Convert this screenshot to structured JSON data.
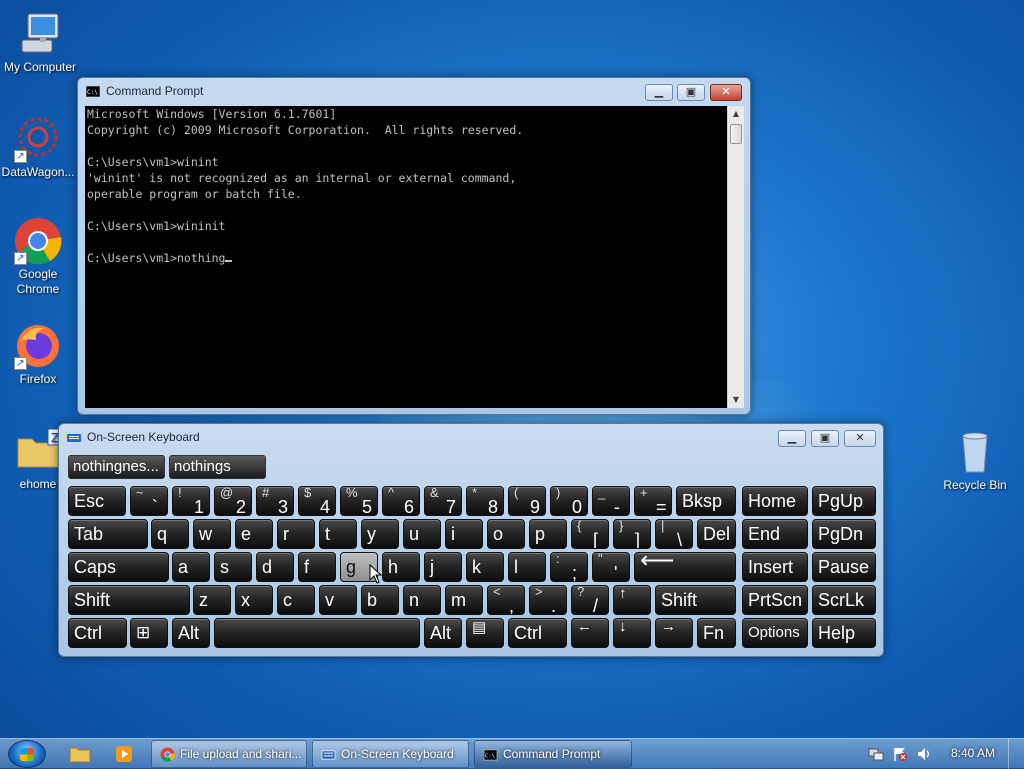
{
  "desktop": {
    "icons": [
      {
        "label": "My Computer"
      },
      {
        "label": "DataWagon..."
      },
      {
        "label": "Google Chrome"
      },
      {
        "label": "Firefox"
      },
      {
        "label": "ehome"
      },
      {
        "label": "Recycle Bin"
      }
    ]
  },
  "cmd": {
    "title": "Command Prompt",
    "icon": "cmd-icon",
    "lines": [
      "Microsoft Windows [Version 6.1.7601]",
      "Copyright (c) 2009 Microsoft Corporation.  All rights reserved.",
      "",
      "C:\\Users\\vm1>winint",
      "'winint' is not recognized as an internal or external command,",
      "operable program or batch file.",
      "",
      "C:\\Users\\vm1>wininit",
      "",
      "C:\\Users\\vm1>nothing"
    ]
  },
  "osk": {
    "title": "On-Screen Keyboard",
    "suggestions": [
      "nothingnes...",
      "nothings"
    ],
    "keys": {
      "esc": "Esc",
      "grave": {
        "shift": "~",
        "main": "`"
      },
      "d1": {
        "shift": "!",
        "main": "1"
      },
      "d2": {
        "shift": "@",
        "main": "2"
      },
      "d3": {
        "shift": "#",
        "main": "3"
      },
      "d4": {
        "shift": "$",
        "main": "4"
      },
      "d5": {
        "shift": "%",
        "main": "5"
      },
      "d6": {
        "shift": "^",
        "main": "6"
      },
      "d7": {
        "shift": "&",
        "main": "7"
      },
      "d8": {
        "shift": "*",
        "main": "8"
      },
      "d9": {
        "shift": "(",
        "main": "9"
      },
      "d0": {
        "shift": ")",
        "main": "0"
      },
      "minus": {
        "shift": "_",
        "main": "-"
      },
      "equals": {
        "shift": "+",
        "main": "="
      },
      "bksp": "Bksp",
      "home": "Home",
      "pgup": "PgUp",
      "tab": "Tab",
      "q": "q",
      "w": "w",
      "e": "e",
      "r": "r",
      "t": "t",
      "y": "y",
      "u": "u",
      "i": "i",
      "o": "o",
      "p": "p",
      "lbracket": {
        "shift": "{",
        "main": "["
      },
      "rbracket": {
        "shift": "}",
        "main": "]"
      },
      "backslash": {
        "shift": "|",
        "main": "\\"
      },
      "del": "Del",
      "end": "End",
      "pgdn": "PgDn",
      "caps": "Caps",
      "a": "a",
      "s": "s",
      "d": "d",
      "f": "f",
      "g": "g",
      "h": "h",
      "j": "j",
      "k": "k",
      "l": "l",
      "semicolon": {
        "shift": ":",
        "main": ";"
      },
      "quote": {
        "shift": "\"",
        "main": "'"
      },
      "enter": "⟵",
      "insert": "Insert",
      "pause": "Pause",
      "shift_l": "Shift",
      "z": "z",
      "x": "x",
      "c": "c",
      "v": "v",
      "b": "b",
      "n": "n",
      "m": "m",
      "comma": {
        "shift": "<",
        "main": ","
      },
      "period": {
        "shift": ">",
        "main": "."
      },
      "slash": {
        "shift": "?",
        "main": "/"
      },
      "up": "↑",
      "shift_r": "Shift",
      "prtscn": "PrtScn",
      "scrlk": "ScrLk",
      "ctrl_l": "Ctrl",
      "win": "⊞",
      "alt_l": "Alt",
      "alt_r": "Alt",
      "menu": "▤",
      "ctrl_r": "Ctrl",
      "left": "←",
      "down": "↓",
      "right": "→",
      "fn": "Fn",
      "options": "Options",
      "help": "Help"
    }
  },
  "taskbar": {
    "buttons": [
      {
        "label": "File upload and shari..."
      },
      {
        "label": "On-Screen Keyboard"
      },
      {
        "label": "Command Prompt"
      }
    ],
    "clock": "8:40 AM"
  }
}
